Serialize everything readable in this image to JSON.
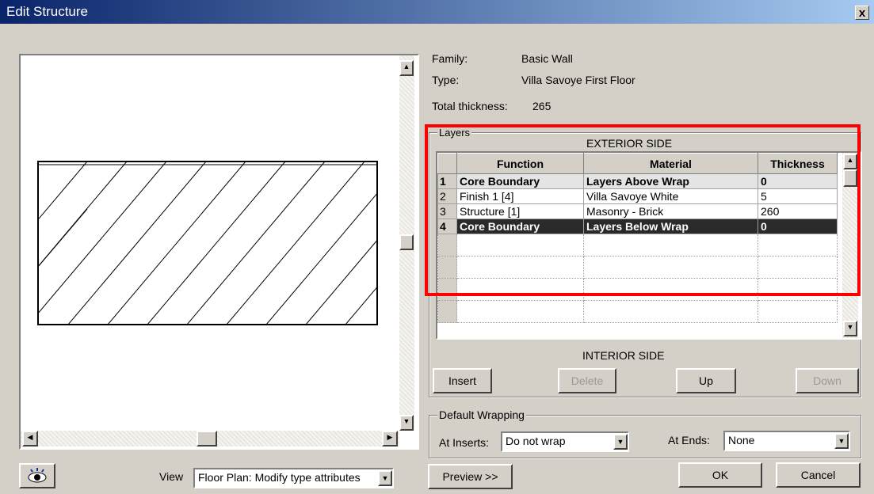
{
  "window": {
    "title": "Edit Structure",
    "close_label": "x"
  },
  "info": {
    "family_label": "Family:",
    "family_value": "Basic Wall",
    "type_label": "Type:",
    "type_value": "Villa Savoye First Floor",
    "thickness_label": "Total thickness:",
    "thickness_value": "265"
  },
  "layers": {
    "group_label": "Layers",
    "exterior_label": "EXTERIOR SIDE",
    "interior_label": "INTERIOR SIDE",
    "columns": [
      "Function",
      "Material",
      "Thickness"
    ],
    "rows": [
      {
        "index": "1",
        "function": "Core Boundary",
        "material": "Layers Above Wrap",
        "thickness": "0"
      },
      {
        "index": "2",
        "function": "Finish 1 [4]",
        "material": "Villa Savoye White",
        "thickness": "5"
      },
      {
        "index": "3",
        "function": "Structure  [1]",
        "material": "Masonry - Brick",
        "thickness": "260"
      },
      {
        "index": "4",
        "function": "Core Boundary",
        "material": "Layers Below Wrap",
        "thickness": "0"
      }
    ]
  },
  "buttons": {
    "insert": "Insert",
    "delete": "Delete",
    "up": "Up",
    "down": "Down",
    "preview": "Preview >>",
    "ok": "OK",
    "cancel": "Cancel"
  },
  "wrapping": {
    "group_label": "Default Wrapping",
    "inserts_label": "At Inserts:",
    "inserts_value": "Do not wrap",
    "ends_label": "At Ends:",
    "ends_value": "None"
  },
  "view": {
    "label": "View",
    "value": "Floor Plan: Modify type attributes"
  },
  "colors": {
    "highlight": "#ff0000",
    "selected_row": "#2a2a2a",
    "title_start": "#0a246a"
  }
}
